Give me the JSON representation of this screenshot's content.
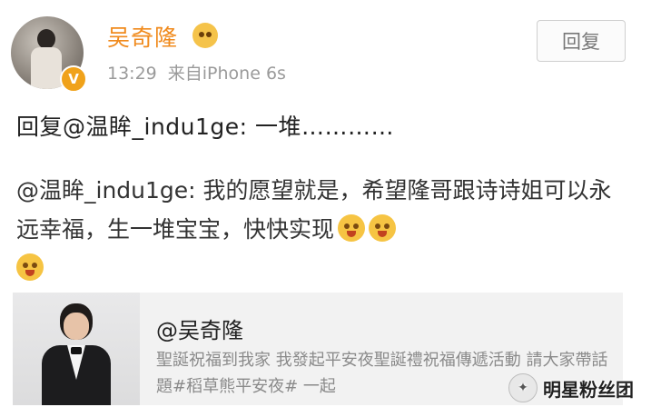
{
  "post": {
    "username": "吴奇隆",
    "time": "13:29",
    "source": "来自iPhone 6s",
    "reply_button": "回复",
    "reply_text": "回复@温眸_indu1ge: 一堆…………",
    "quoted_text": "@温眸_indu1ge: 我的愿望就是，希望隆哥跟诗诗姐可以永远幸福，生一堆宝宝，快快实现"
  },
  "card": {
    "title": "@吴奇隆",
    "description": "聖誕祝福到我家 我發起平安夜聖誕禮祝福傳遞活動 請大家帶話題#稻草熊平安夜# 一起"
  },
  "watermark": {
    "text": "明星粉丝团"
  },
  "icons": {
    "avatar": "avatar-photo",
    "verified": "verified-v-badge-icon",
    "member": "member-emoji-icon",
    "emoji": "laughing-tears-emoji-icon",
    "watermark": "wechat-account-icon"
  },
  "colors": {
    "username": "#f08a1c",
    "verified_badge": "#f0a21a",
    "meta_text": "#9a9a9a",
    "card_background": "#f2f2f2"
  }
}
